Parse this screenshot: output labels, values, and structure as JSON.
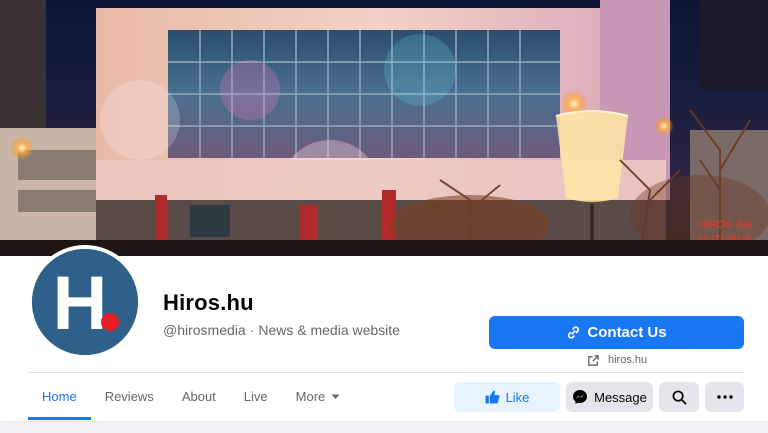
{
  "page": {
    "name": "Hiros.hu",
    "handle": "@hirosmedia",
    "separator": "·",
    "category": "News & media website",
    "logo_letter": "H",
    "brand_color": "#2f6089",
    "logo_dot_color": "#e81c24"
  },
  "contact": {
    "label": "Contact Us",
    "website": "hiros.hu"
  },
  "tabs": [
    {
      "label": "Home",
      "active": true
    },
    {
      "label": "Reviews",
      "active": false
    },
    {
      "label": "About",
      "active": false
    },
    {
      "label": "Live",
      "active": false
    },
    {
      "label": "More",
      "active": false
    }
  ],
  "actions": {
    "like_label": "Like",
    "message_label": "Message",
    "search_icon": "search-icon",
    "more_icon": "more-icon"
  },
  "cover": {
    "sign_text_1": "HIROS AG",
    "sign_text_2": "NUTOBUS"
  },
  "colors": {
    "accent": "#1877f2",
    "like_bg": "#e7f3ff",
    "secondary_bg": "#e4e6eb"
  }
}
